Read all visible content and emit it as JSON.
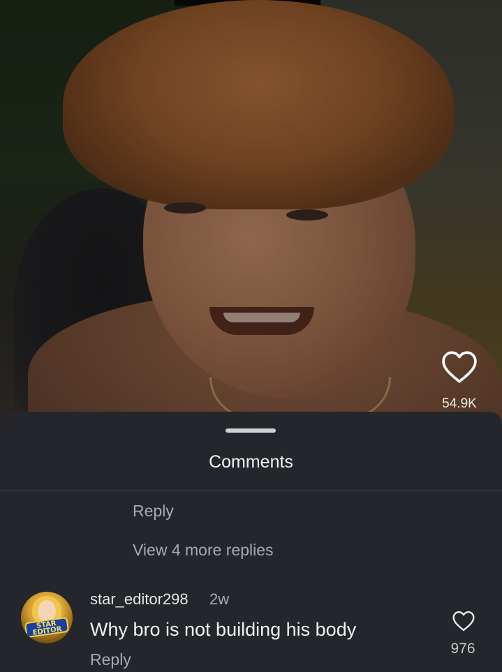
{
  "video": {
    "like_count": "54.9K",
    "like_icon": "heart-outline-icon"
  },
  "comments_sheet": {
    "title": "Comments",
    "thread": {
      "reply_label": "Reply",
      "view_more_label": "View 4 more replies"
    },
    "comments": [
      {
        "username": "star_editor298",
        "time": "2w",
        "text": "Why bro is not building his body",
        "reply_label": "Reply",
        "like_count": "976",
        "like_icon": "heart-outline-icon",
        "avatar_text": "STAR EDITOR"
      }
    ]
  },
  "colors": {
    "sheet_background": "#24262b",
    "primary_text": "#f1f2f3",
    "secondary_text": "#a6a9ae"
  }
}
